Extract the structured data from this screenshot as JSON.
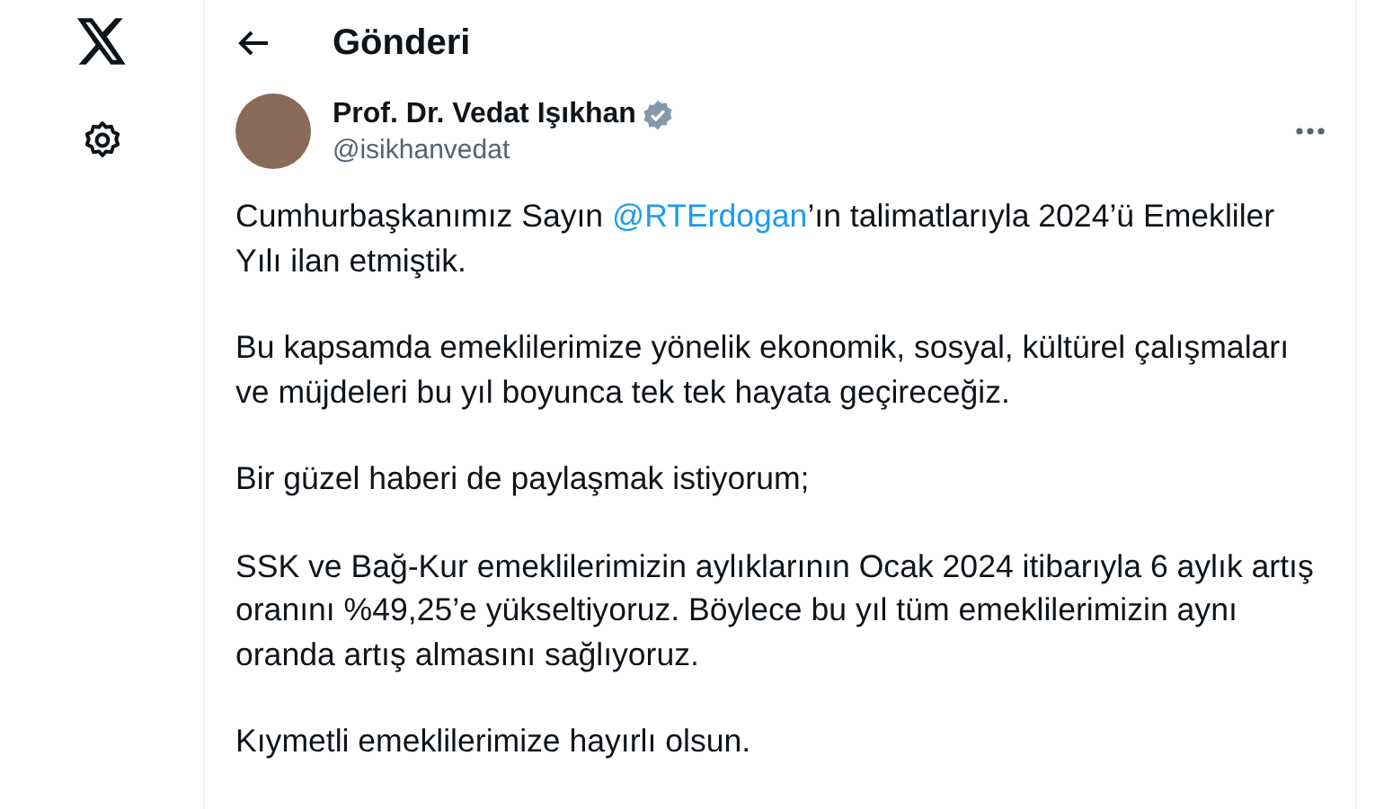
{
  "header": {
    "title": "Gönderi"
  },
  "author": {
    "name": "Prof. Dr. Vedat Işıkhan",
    "verified": true,
    "handle": "@isikhanvedat"
  },
  "paragraphs": [
    [
      {
        "kind": "text",
        "text": "Cumhurbaşkanımız Sayın "
      },
      {
        "kind": "mention",
        "text": "@RTErdogan"
      },
      {
        "kind": "text",
        "text": "’ın talimatlarıyla 2024’ü Emekliler Yılı ilan etmiştik."
      }
    ],
    [
      {
        "kind": "text",
        "text": "Bu kapsamda emeklilerimize yönelik ekonomik, sosyal, kültürel çalışmaları ve müjdeleri bu yıl boyunca tek tek hayata geçireceğiz."
      }
    ],
    [
      {
        "kind": "text",
        "text": "Bir güzel haberi de paylaşmak istiyorum;"
      }
    ],
    [
      {
        "kind": "text",
        "text": "SSK ve Bağ-Kur emeklilerimizin aylıklarının Ocak 2024 itibarıyla 6 aylık artış oranını %49,25’e yükseltiyoruz. Böylece bu yıl tüm emeklilerimizin aynı oranda artış almasını sağlıyoruz."
      }
    ],
    [
      {
        "kind": "text",
        "text": "Kıymetli emeklilerimize hayırlı olsun."
      }
    ]
  ]
}
